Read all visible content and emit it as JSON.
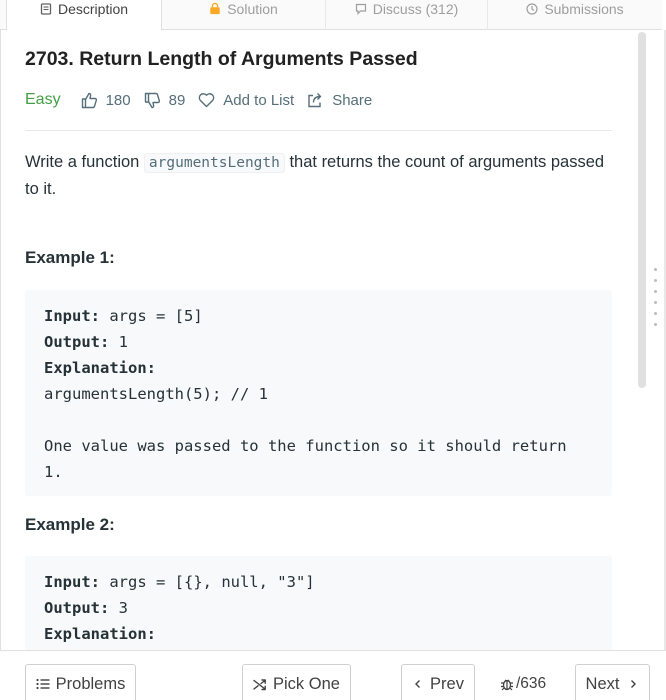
{
  "tabs": [
    {
      "label": "Description",
      "icon": "document-icon",
      "active": true
    },
    {
      "label": "Solution",
      "icon": "lock-icon",
      "active": false
    },
    {
      "label": "Discuss (312)",
      "icon": "comment-icon",
      "active": false
    },
    {
      "label": "Submissions",
      "icon": "clock-icon",
      "active": false
    }
  ],
  "problem": {
    "title": "2703. Return Length of Arguments Passed",
    "difficulty": "Easy",
    "likes": "180",
    "dislikes": "89",
    "add_to_list": "Add to List",
    "share": "Share",
    "description_before": "Write a function ",
    "description_code": "argumentsLength",
    "description_after": " that returns the count of arguments passed to it."
  },
  "examples": [
    {
      "title": "Example 1:",
      "input_label": "Input:",
      "input_value": " args = [5]",
      "output_label": "Output:",
      "output_value": " 1",
      "explanation_label": "Explanation:",
      "explanation_lines": [
        "argumentsLength(5); // 1",
        "",
        "One value was passed to the function so it should return",
        "1."
      ]
    },
    {
      "title": "Example 2:",
      "input_label": "Input:",
      "input_value": " args = [{}, null, \"3\"]",
      "output_label": "Output:",
      "output_value": " 3",
      "explanation_label": "Explanation:"
    }
  ],
  "bottombar": {
    "problems": "Problems",
    "pick_one": "Pick One",
    "prev": "Prev",
    "counter": "/636",
    "next": "Next"
  },
  "colors": {
    "easy": "#43a047",
    "code_bg": "#f7f9fa",
    "border": "#e0e0e0"
  }
}
